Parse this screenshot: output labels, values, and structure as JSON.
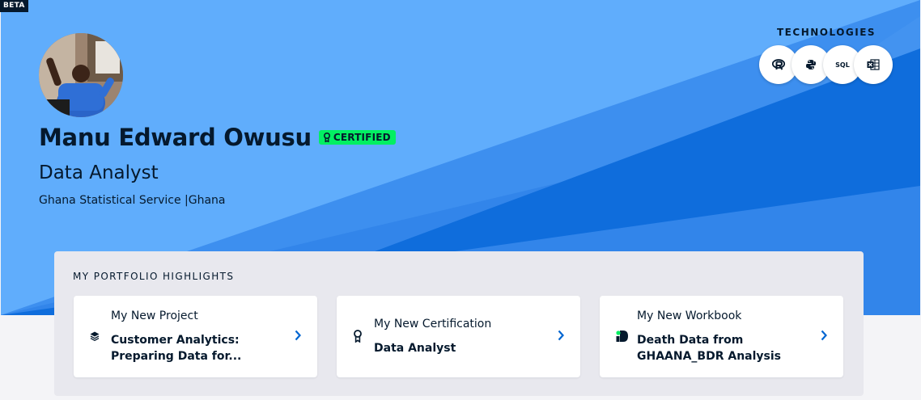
{
  "beta_label": "BETA",
  "profile": {
    "name": "Manu Edward Owusu",
    "certified_label": "CERTIFIED",
    "job_title": "Data Analyst",
    "organization": "Ghana Statistical Service",
    "separator": "|",
    "country": "Ghana"
  },
  "technologies": {
    "label": "TECHNOLOGIES",
    "items": [
      {
        "name": "R",
        "icon": "r-icon"
      },
      {
        "name": "Python",
        "icon": "python-icon"
      },
      {
        "name": "SQL",
        "icon": "sql-icon",
        "text": "SQL"
      },
      {
        "name": "Excel",
        "icon": "excel-icon"
      }
    ]
  },
  "highlights": {
    "label": "MY PORTFOLIO HIGHLIGHTS",
    "cards": [
      {
        "kicker": "My New Project",
        "title": "Customer Analytics: Preparing Data for...",
        "icon": "layers-icon"
      },
      {
        "kicker": "My New Certification",
        "title": "Data Analyst",
        "icon": "certificate-icon"
      },
      {
        "kicker": "My New Workbook",
        "title": "Death Data from GHAANA_BDR Analysis",
        "icon": "workbook-icon"
      }
    ]
  },
  "colors": {
    "hero_light": "#60adfc",
    "hero_mid": "#3d8fef",
    "hero_dark": "#0f6ddc",
    "navy": "#05192d",
    "certified_green": "#03ef62",
    "link_blue": "#0065d1"
  }
}
